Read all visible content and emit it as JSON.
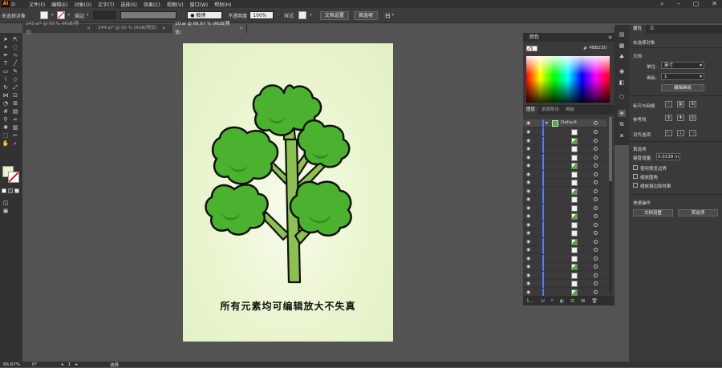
{
  "menubar": {
    "logo": "Ai",
    "items": [
      "文件(F)",
      "编辑(E)",
      "对象(O)",
      "文字(T)",
      "选择(S)",
      "效果(C)",
      "视图(V)",
      "窗口(W)",
      "帮助(H)"
    ]
  },
  "controlbar": {
    "selection_label": "未选择对象",
    "stroke_label": "描边",
    "brush_label": "● 触摸",
    "opacity_label": "不透明度",
    "opacity_value": "100%",
    "style_label": "样式",
    "doc_settings": "文档设置",
    "preferences": "首选项"
  },
  "tabs": [
    {
      "label": "243.ai* @ 50 % (RGB/预览)",
      "active": false
    },
    {
      "label": "244.ai* @ 50 % (RGB/预览)",
      "active": false
    },
    {
      "label": "10.ai @ 66.67 % (RGB/预览)",
      "active": true
    }
  ],
  "artboard": {
    "caption": "所有元素均可编辑放大不失真"
  },
  "color_panel": {
    "title": "颜色",
    "hex": "4BB230"
  },
  "layers_panel": {
    "tabs": [
      "图层",
      "资源导出",
      "画板"
    ],
    "top_layer": "Default",
    "footer": "1..."
  },
  "properties": {
    "tabs": [
      "属性",
      "库"
    ],
    "no_selection": "未选择对象",
    "document_section": "文档",
    "units_label": "单位:",
    "units_value": "英寸",
    "artboard_label": "画板:",
    "artboard_value": "1",
    "edit_artboards": "编辑画板",
    "rulers_grids": "标尺与网格",
    "guides": "参考线",
    "align_options": "对齐选项",
    "preferences_section": "首选项",
    "keyboard_increment_label": "键盘增量:",
    "keyboard_increment_value": "0.0139 in",
    "opt_preview_bounds": "使用预览边界",
    "opt_scale_corners": "缩放圆角",
    "opt_scale_strokes": "缩放描边和效果",
    "quick_actions": "快速操作",
    "btn_doc_settings": "文档设置",
    "btn_preferences": "首选项"
  },
  "statusbar": {
    "zoom": "66.67%",
    "angle": "0°",
    "page": "1",
    "tool": "选择"
  },
  "colors": {
    "tree_green": "#4BB230",
    "trunk_green": "#8cc152",
    "accent_blue": "#4a7cff"
  }
}
